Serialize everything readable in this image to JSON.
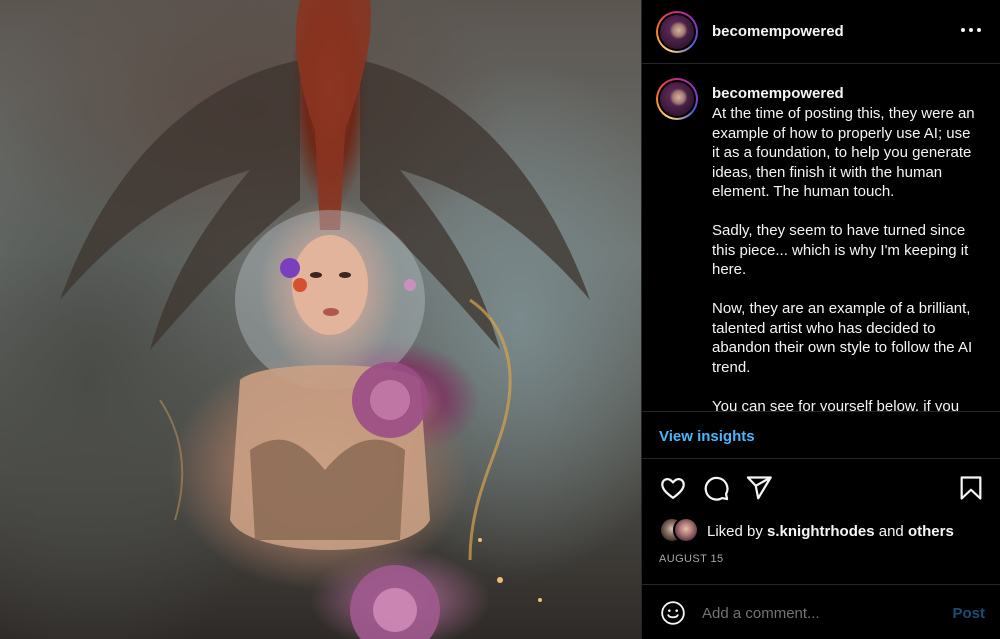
{
  "post": {
    "username": "becomempowered",
    "more_icon": "more-horizontal-icon"
  },
  "caption": {
    "username": "becomempowered",
    "text": "At the time of posting this, they were an example of how to properly use AI; use it as a foundation, to help you generate ideas, then finish it with the human element. The human touch.\n\nSadly, they seem to have turned since this piece... which is why I'm keeping it here.\n\nNow, they are an example of a brilliant, talented artist who has decided to abandon their own style to follow the AI trend.\n\nYou can see for yourself below, if you"
  },
  "insights": {
    "label": "View insights"
  },
  "actions": {
    "like_icon": "heart-icon",
    "comment_icon": "comment-icon",
    "share_icon": "send-icon",
    "save_icon": "bookmark-icon"
  },
  "likes": {
    "prefix": "Liked by ",
    "user": "s.knightrhodes",
    "conjunction": " and ",
    "others": "others"
  },
  "date": "AUGUST 15",
  "comment": {
    "emoji_icon": "emoji-icon",
    "placeholder": "Add a comment...",
    "post_label": "Post"
  },
  "colors": {
    "background": "#000000",
    "link_blue": "#4cb5f9",
    "post_disabled": "#1d4d75",
    "muted": "#a8a8a8",
    "divider": "#262626"
  }
}
